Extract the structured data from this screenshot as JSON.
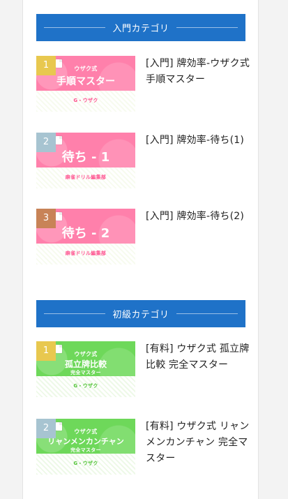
{
  "categories": [
    {
      "label": "入門カテゴリ",
      "items": [
        {
          "rank": "1",
          "thumb_subtitle": "ウザク式",
          "thumb_title": "手順マスター",
          "thumb_title_sub": "",
          "thumb_author": "G・ウザク",
          "title": "[入門] 牌効率-ウザク式 手順マスター"
        },
        {
          "rank": "2",
          "thumb_subtitle": "",
          "thumb_title": "待ち - 1",
          "thumb_title_sub": "",
          "thumb_author": "麻雀ドリル編集部",
          "title": "[入門] 牌効率-待ち(1)"
        },
        {
          "rank": "3",
          "thumb_subtitle": "",
          "thumb_title": "待ち - 2",
          "thumb_title_sub": "",
          "thumb_author": "麻雀ドリル編集部",
          "title": "[入門] 牌効率-待ち(2)"
        }
      ]
    },
    {
      "label": "初級カテゴリ",
      "items": [
        {
          "rank": "1",
          "thumb_subtitle": "ウザク式",
          "thumb_title": "孤立牌比較",
          "thumb_title_sub": "完全マスター",
          "thumb_author": "G・ウザク",
          "title": "[有料] ウザク式 孤立牌比較 完全マスター"
        },
        {
          "rank": "2",
          "thumb_subtitle": "ウザク式",
          "thumb_title": "リャンメンカンチャン",
          "thumb_title_sub": "完全マスター",
          "thumb_author": "G・ウザク",
          "title": "[有料] ウザク式 リャンメンカンチャン 完全マスター"
        }
      ]
    }
  ],
  "colors": {
    "header_bg": "#1f72c8",
    "pink": "#ff80ab",
    "green": "#6ed85a",
    "gold": "#e8c84f",
    "silver": "#a7c4d1",
    "bronze": "#c88357"
  }
}
